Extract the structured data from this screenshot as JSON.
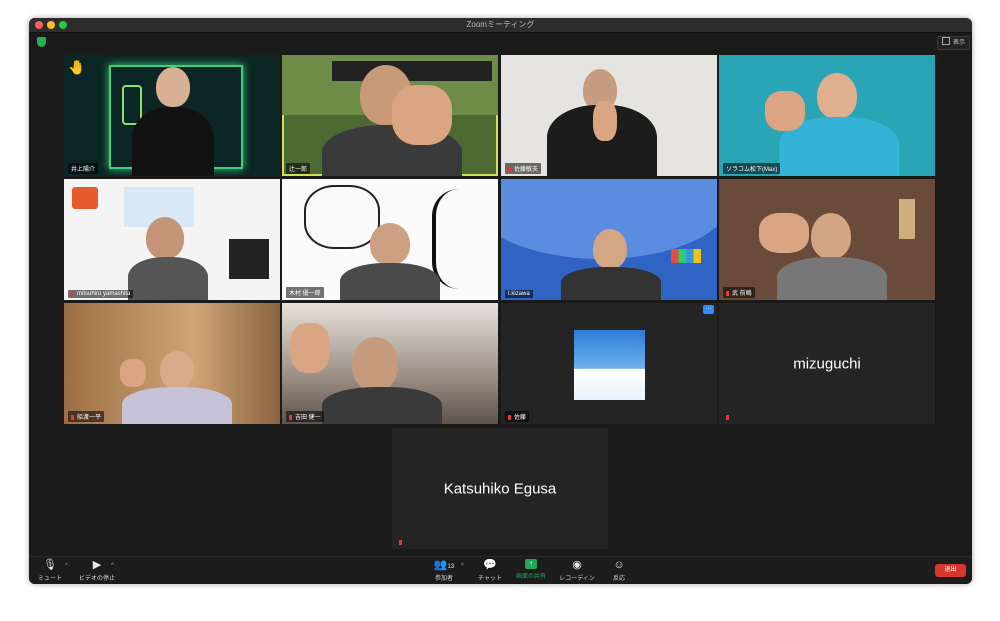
{
  "window": {
    "title": "Zoomミーティング",
    "view_label": "表示"
  },
  "participants": [
    {
      "name": "井上陽介",
      "bg": "#0c2b2a",
      "overlay": "🤚"
    },
    {
      "name": "辻一郎",
      "bg": "#4d6a35"
    },
    {
      "name": "佐藤敏夫",
      "bg": "#e6e4e0"
    },
    {
      "name": "ソラコム松下(Max)",
      "bg": "#2aa5b5"
    },
    {
      "name": "mitsuhiro yamashita",
      "bg": "#f4f4f4"
    },
    {
      "name": "木村 優一郎",
      "bg": "#fafafa"
    },
    {
      "name": "t.kizawa",
      "bg": "#2f63c4"
    },
    {
      "name": "武 前嶋",
      "bg": "#6a4a3a"
    },
    {
      "name": "船渡一平",
      "bg": "#b58a5e"
    },
    {
      "name": "吉田 健一",
      "bg": "#8a7e78"
    },
    {
      "name": "佐藤",
      "bg": "#242424"
    },
    {
      "name": "mizuguchi",
      "bg": "#242424"
    },
    {
      "name": "Katsuhiko Egusa",
      "bg": "#242424"
    }
  ],
  "toolbar": {
    "mute": "ミュート",
    "video": "ビデオの停止",
    "participants": "参加者",
    "participants_count": "13",
    "chat": "チャット",
    "share": "画面の共有",
    "record": "レコーディング",
    "reactions": "反応",
    "leave": "退出"
  },
  "icons": [
    "shield-icon",
    "microphone-icon",
    "video-camera-icon",
    "participants-icon",
    "chat-icon",
    "share-screen-icon",
    "record-icon",
    "reaction-icon",
    "raised-hand-icon",
    "more-options-icon"
  ],
  "colors": {
    "accent_green": "#23b14d",
    "leave_red": "#d6362b",
    "share_green": "#1fa85a",
    "active_speaker": "#d4e157"
  }
}
